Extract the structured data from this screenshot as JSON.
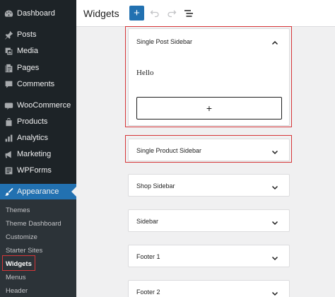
{
  "sidebar": {
    "items": [
      {
        "label": "Dashboard",
        "icon": "dashboard-icon"
      },
      {
        "label": "Posts",
        "icon": "pin-icon"
      },
      {
        "label": "Media",
        "icon": "media-icon"
      },
      {
        "label": "Pages",
        "icon": "pages-icon"
      },
      {
        "label": "Comments",
        "icon": "comments-icon"
      },
      {
        "label": "WooCommerce",
        "icon": "woocommerce-icon"
      },
      {
        "label": "Products",
        "icon": "products-icon"
      },
      {
        "label": "Analytics",
        "icon": "analytics-icon"
      },
      {
        "label": "Marketing",
        "icon": "marketing-icon"
      },
      {
        "label": "WPForms",
        "icon": "wpforms-icon"
      },
      {
        "label": "Appearance",
        "icon": "appearance-icon"
      }
    ],
    "submenu": [
      "Themes",
      "Theme Dashboard",
      "Customize",
      "Starter Sites",
      "Widgets",
      "Menus",
      "Header"
    ]
  },
  "header": {
    "title": "Widgets",
    "add_label": "+"
  },
  "widget_areas": [
    {
      "title": "Single Post Sidebar",
      "expanded": true,
      "content": "Hello",
      "add_block_label": "+"
    },
    {
      "title": "Single Product Sidebar",
      "expanded": false
    },
    {
      "title": "Shop Sidebar",
      "expanded": false
    },
    {
      "title": "Sidebar",
      "expanded": false
    },
    {
      "title": "Footer 1",
      "expanded": false
    },
    {
      "title": "Footer 2",
      "expanded": false
    }
  ],
  "colors": {
    "accent": "#2271b1",
    "highlight": "#d63638",
    "sidebar_bg": "#1d2327"
  }
}
